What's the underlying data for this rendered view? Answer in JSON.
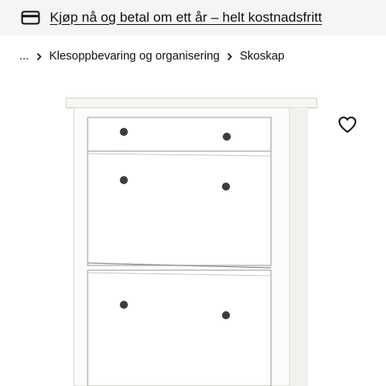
{
  "promo": {
    "text": "Kjøp nå og betal om ett år – helt kostnadsfritt",
    "icon": "credit-card-icon"
  },
  "breadcrumb": {
    "ellipsis": "...",
    "items": [
      "Klesoppbevaring og organisering",
      "Skoskap"
    ]
  },
  "product": {
    "image_icon": "white-shoe-cabinet-image",
    "favourite_icon": "heart-outline-icon"
  }
}
